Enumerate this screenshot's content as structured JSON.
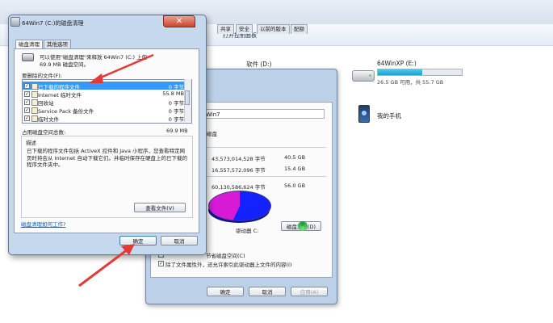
{
  "explorer": {
    "control_panel": "打开控制面板",
    "drives": [
      {
        "name": "软件 (D:)",
        "used_fraction": 0.1,
        "free": ""
      },
      {
        "name": "64WinXP (E:)",
        "used_fraction": 0.53,
        "free": "26.5 GB 可用，共 55.7 GB"
      }
    ],
    "phone": "我的手机"
  },
  "properties": {
    "tabs": [
      "共享",
      "安全",
      "以前的版本",
      "配额"
    ],
    "name_value": "Win7",
    "type_label": "磁盘",
    "rows": [
      {
        "bytes": "43,573,014,528 字节",
        "size": "40.5 GB"
      },
      {
        "bytes": "16,557,572,096 字节",
        "size": "15.4 GB"
      },
      {
        "bytes": "60,130,586,624 字节",
        "size": "56.0 GB"
      }
    ],
    "drive_label": "驱动器 C:",
    "cleanup_button": "磁盘清理(D)",
    "compress_text": "节省磁盘空间(C)",
    "index_text": "除了文件属性外，还允许索引此驱动器上文件的内容(I)",
    "buttons": {
      "ok": "确定",
      "cancel": "取消",
      "apply": "应用(A)"
    }
  },
  "cleanup": {
    "title": "64Win7 (C:)的磁盘清理",
    "close": "✕",
    "tabs": [
      "磁盘清理",
      "其他选项"
    ],
    "intro_line1": "可以使用\"磁盘清理\"来释放 64Win7 (C:) 上的",
    "intro_line2": "69.9 MB 磁盘空间。",
    "list_label": "要删除的文件(F):",
    "files": [
      {
        "checked": true,
        "label": "已下载的程序文件",
        "size": "0 字节"
      },
      {
        "checked": true,
        "label": "Internet 临时文件",
        "size": "55.8 MB"
      },
      {
        "checked": true,
        "label": "回收站",
        "size": "0 字节"
      },
      {
        "checked": true,
        "label": "Service Pack 备份文件",
        "size": "0 字节"
      },
      {
        "checked": true,
        "label": "临时文件",
        "size": "0 字节"
      }
    ],
    "total_label": "占用磁盘空间总数:",
    "total_value": "69.9 MB",
    "desc_title": "描述",
    "desc_text": "已下载的程序文件包括 ActiveX 控件和 Java 小程序，您查看特定网页时将会从 Internet 自动下载它们。并临时保存在硬盘上的已下载的程序文件夹中。",
    "view_files": "查看文件(V)",
    "how_link": "磁盘清理如何工作?",
    "ok": "确定",
    "cancel": "取消"
  },
  "colors": {
    "selection": "#3399ff",
    "annotation": "#e53935",
    "pie_used": "#1422ff",
    "pie_free": "#d61ad6"
  }
}
